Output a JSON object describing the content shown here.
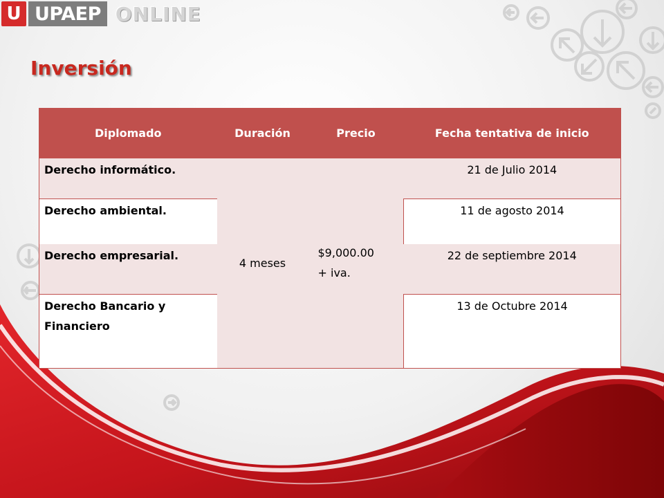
{
  "header": {
    "logo_mark": "U",
    "logo_brand": "UPAEP",
    "logo_suffix": "ONLINE"
  },
  "title": "Inversión",
  "table": {
    "headers": [
      "Diplomado",
      "Duración",
      "Precio",
      "Fecha tentativa de inicio"
    ],
    "duration": "4 meses",
    "price_line1": "$9,000.00",
    "price_line2": "+ iva.",
    "rows": [
      {
        "name": "Derecho informático.",
        "date": "21 de Julio 2014"
      },
      {
        "name": "Derecho ambiental.",
        "date": "11 de agosto 2014"
      },
      {
        "name": "Derecho empresarial.",
        "date": "22 de septiembre 2014"
      },
      {
        "name": "Derecho Bancario y Financiero",
        "date": "13 de Octubre 2014"
      }
    ]
  },
  "colors": {
    "brand_red": "#d52b2b",
    "header_fill": "#c0504d",
    "row_shade": "#f2e3e3",
    "title_red": "#c8281f"
  },
  "icons": [
    "arrow-circle-icon"
  ]
}
